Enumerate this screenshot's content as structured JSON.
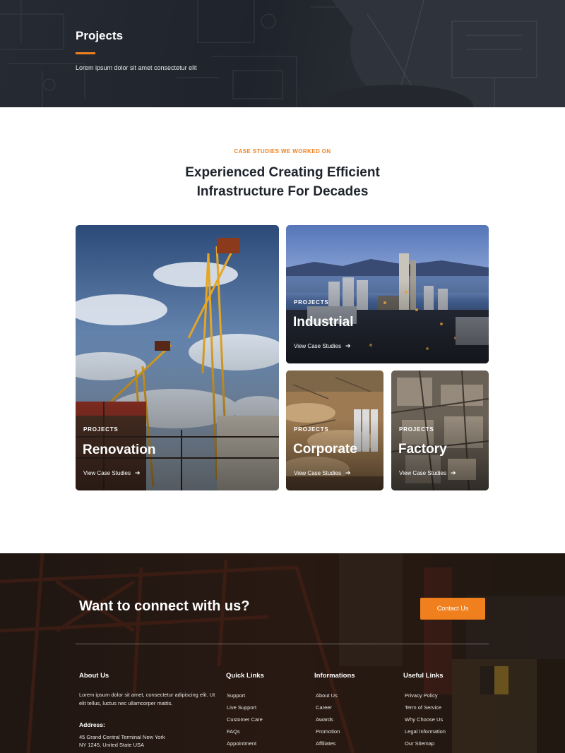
{
  "hero": {
    "title": "Projects",
    "subtitle": "Lorem ipsum dolor sit amet consectetur elit"
  },
  "intro": {
    "eyebrow": "CASE STUDIES WE WORKED ON",
    "headline_line1": "Experienced Creating Efficient",
    "headline_line2": "Infrastructure For Decades"
  },
  "projects": [
    {
      "kicker": "PROJECTS",
      "name": "Renovation",
      "link": "View Case Studies"
    },
    {
      "kicker": "PROJECTS",
      "name": "Industrial",
      "link": "View Case Studies"
    },
    {
      "kicker": "PROJECTS",
      "name": "Corporate",
      "link": "View Case Studies"
    },
    {
      "kicker": "PROJECTS",
      "name": "Factory",
      "link": "View Case Studies"
    }
  ],
  "footer": {
    "cta": "Want to connect with us?",
    "cta_button": "Contact Us",
    "about": {
      "heading": "About Us",
      "text": "Lorem ipsum dolor sit amet, consectetur adipiscing elit. Ut elit tellus, luctus nec ullamcorper mattis.",
      "address_heading": "Address:",
      "address_line1": "45 Grand Central Terminal New York",
      "address_line2": "NY 1245, United State USA"
    },
    "quick_links": {
      "heading": "Quick Links",
      "items": [
        "Support",
        "Live Support",
        "Customer Care",
        "FAQs",
        "Appointment"
      ]
    },
    "informations": {
      "heading": "Informations",
      "items": [
        "About Us",
        "Career",
        "Awards",
        "Promotion",
        "Affiliates"
      ]
    },
    "useful_links": {
      "heading": "Useful Links",
      "items": [
        "Privacy Policy",
        "Term of Service",
        "Why Choose Us",
        "Legal Information",
        "Our Sitemap"
      ]
    }
  },
  "colors": {
    "accent": "#f0801d",
    "dark": "#1f232b"
  },
  "icons": {
    "card_link_arrow": "arrow-right-icon"
  }
}
